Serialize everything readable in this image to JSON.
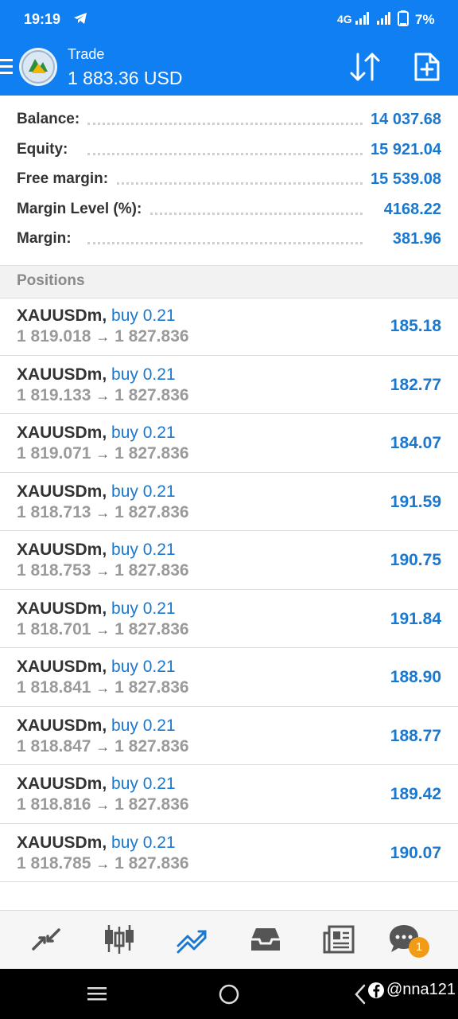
{
  "status_bar": {
    "time": "19:19",
    "network": "4G",
    "battery": "7%"
  },
  "header": {
    "title": "Trade",
    "balance": "1 883.36 USD",
    "background_color": "#0f7ff2"
  },
  "summary": [
    {
      "label": "Balance:",
      "value": "14 037.68"
    },
    {
      "label": "Equity:",
      "value": "15 921.04"
    },
    {
      "label": "Free margin:",
      "value": "15 539.08"
    },
    {
      "label": "Margin Level (%):",
      "value": "4168.22"
    },
    {
      "label": "Margin:",
      "value": "381.96"
    }
  ],
  "positions_header": "Positions",
  "positions": [
    {
      "symbol": "XAUUSDm,",
      "side": "buy 0.21",
      "open": "1 819.018",
      "arrow": "→",
      "current": "1 827.836",
      "profit": "185.18"
    },
    {
      "symbol": "XAUUSDm,",
      "side": "buy 0.21",
      "open": "1 819.133",
      "arrow": "→",
      "current": "1 827.836",
      "profit": "182.77"
    },
    {
      "symbol": "XAUUSDm,",
      "side": "buy 0.21",
      "open": "1 819.071",
      "arrow": "→",
      "current": "1 827.836",
      "profit": "184.07"
    },
    {
      "symbol": "XAUUSDm,",
      "side": "buy 0.21",
      "open": "1 818.713",
      "arrow": "→",
      "current": "1 827.836",
      "profit": "191.59"
    },
    {
      "symbol": "XAUUSDm,",
      "side": "buy 0.21",
      "open": "1 818.753",
      "arrow": "→",
      "current": "1 827.836",
      "profit": "190.75"
    },
    {
      "symbol": "XAUUSDm,",
      "side": "buy 0.21",
      "open": "1 818.701",
      "arrow": "→",
      "current": "1 827.836",
      "profit": "191.84"
    },
    {
      "symbol": "XAUUSDm,",
      "side": "buy 0.21",
      "open": "1 818.841",
      "arrow": "→",
      "current": "1 827.836",
      "profit": "188.90"
    },
    {
      "symbol": "XAUUSDm,",
      "side": "buy 0.21",
      "open": "1 818.847",
      "arrow": "→",
      "current": "1 827.836",
      "profit": "188.77"
    },
    {
      "symbol": "XAUUSDm,",
      "side": "buy 0.21",
      "open": "1 818.816",
      "arrow": "→",
      "current": "1 827.836",
      "profit": "189.42"
    },
    {
      "symbol": "XAUUSDm,",
      "side": "buy 0.21",
      "open": "1 818.785",
      "arrow": "→",
      "current": "1 827.836",
      "profit": "190.07"
    }
  ],
  "tabs": [
    {
      "icon": "quotes-icon",
      "active": false
    },
    {
      "icon": "chart-icon",
      "active": false
    },
    {
      "icon": "trade-icon",
      "active": true
    },
    {
      "icon": "history-icon",
      "active": false
    },
    {
      "icon": "news-icon",
      "active": false
    },
    {
      "icon": "chat-icon",
      "active": false
    }
  ],
  "chat_badge": "1",
  "watermark": "@nna121",
  "accent_color": "#1a78cf"
}
